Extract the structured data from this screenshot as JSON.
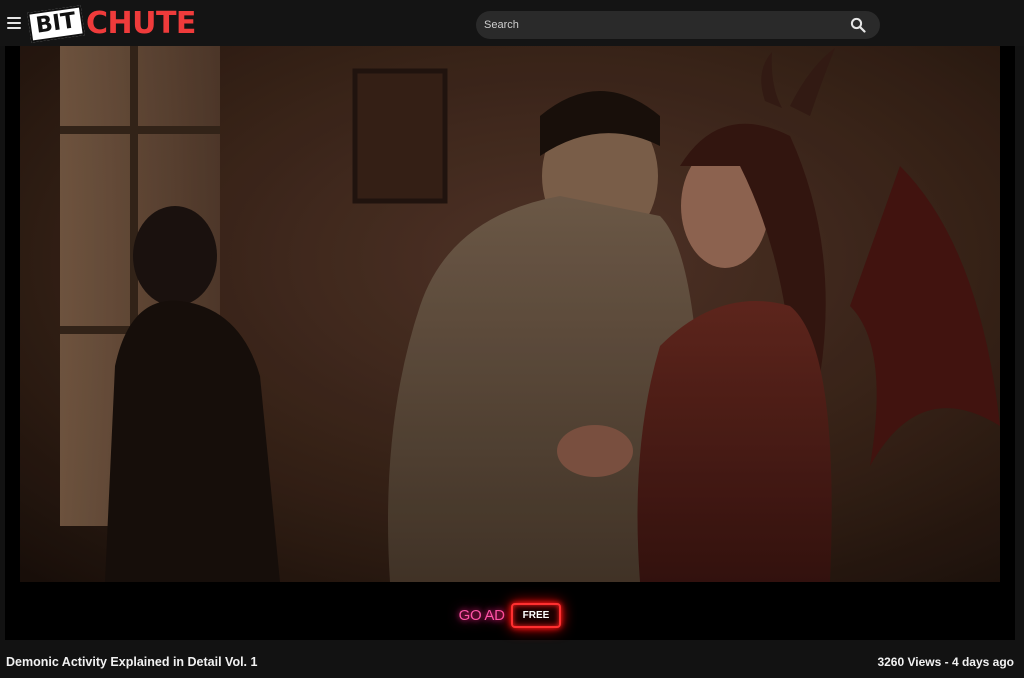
{
  "header": {
    "logo_bit": "BIT",
    "logo_chute": "CHUTE",
    "search_placeholder": "Search"
  },
  "player": {
    "ad": {
      "go_label": "GO AD",
      "free_label": "FREE"
    }
  },
  "video": {
    "title": "Demonic Activity Explained in Detail Vol. 1",
    "views": "3260 Views",
    "separator": " - ",
    "age": "4 days ago"
  },
  "colors": {
    "brand_red": "#ef3b3b",
    "header_bg": "#141414",
    "page_bg": "#121212",
    "ad_pink": "#ff54a8"
  },
  "icons": [
    "menu-icon",
    "search-icon"
  ]
}
